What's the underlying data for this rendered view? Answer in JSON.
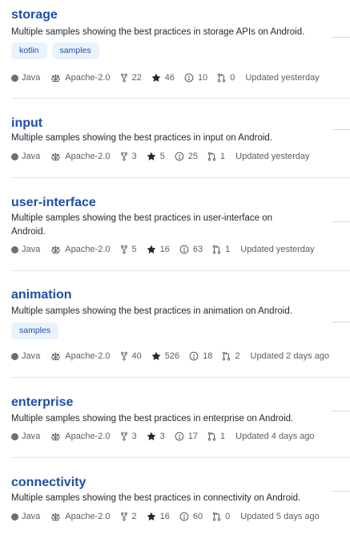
{
  "colors": {
    "java": "#6e6e6e",
    "link": "#1f4fa8",
    "topic_bg": "#eaf3fc",
    "meta_text": "#57606a"
  },
  "repos": [
    {
      "name": "storage",
      "description": "Multiple samples showing the best practices in storage APIs on Android.",
      "topics": [
        "kotlin",
        "samples"
      ],
      "language": "Java",
      "license": "Apache-2.0",
      "forks": "22",
      "stars": "46",
      "issues": "10",
      "pulls": "0",
      "updated": "Updated yesterday"
    },
    {
      "name": "input",
      "description": "Multiple samples showing the best practices in input on Android.",
      "topics": [],
      "language": "Java",
      "license": "Apache-2.0",
      "forks": "3",
      "stars": "5",
      "issues": "25",
      "pulls": "1",
      "updated": "Updated yesterday"
    },
    {
      "name": "user-interface",
      "description": "Multiple samples showing the best practices in user-interface on Android.",
      "topics": [],
      "language": "Java",
      "license": "Apache-2.0",
      "forks": "5",
      "stars": "16",
      "issues": "63",
      "pulls": "1",
      "updated": "Updated yesterday"
    },
    {
      "name": "animation",
      "description": "Multiple samples showing the best practices in animation on Android.",
      "topics": [
        "samples"
      ],
      "language": "Java",
      "license": "Apache-2.0",
      "forks": "40",
      "stars": "526",
      "issues": "18",
      "pulls": "2",
      "updated": "Updated 2 days ago"
    },
    {
      "name": "enterprise",
      "description": "Multiple samples showing the best practices in enterprise on Android.",
      "topics": [],
      "language": "Java",
      "license": "Apache-2.0",
      "forks": "3",
      "stars": "3",
      "issues": "17",
      "pulls": "1",
      "updated": "Updated 4 days ago"
    },
    {
      "name": "connectivity",
      "description": "Multiple samples showing the best practices in connectivity on Android.",
      "topics": [],
      "language": "Java",
      "license": "Apache-2.0",
      "forks": "2",
      "stars": "16",
      "issues": "60",
      "pulls": "0",
      "updated": "Updated 5 days ago"
    }
  ]
}
